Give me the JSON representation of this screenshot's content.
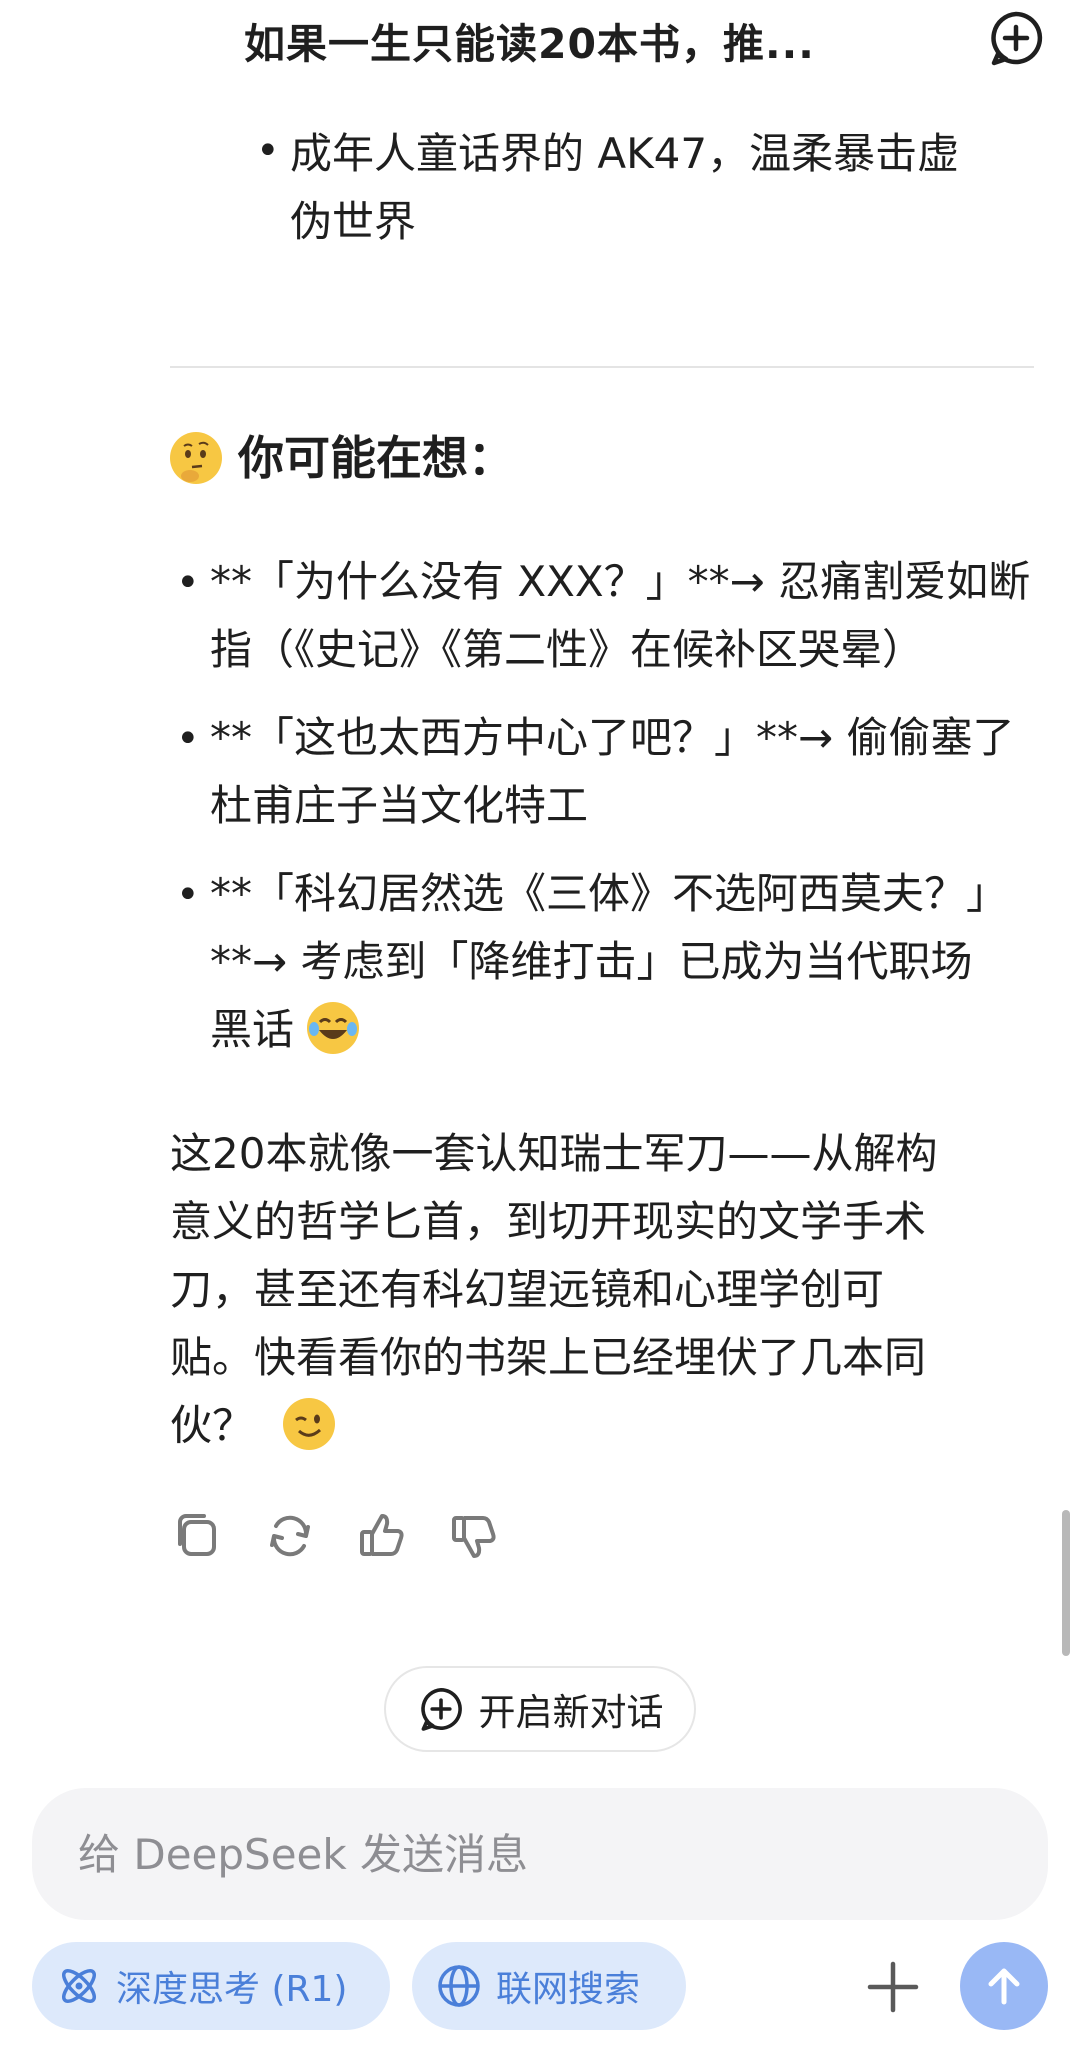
{
  "header": {
    "title": "如果一生只能读20本书，推..."
  },
  "previous_bullet": {
    "line1": "成年人童话界的 AK47，温柔暴击虚",
    "line2": "伪世界"
  },
  "section": {
    "emoji": "thinking-face",
    "title": "你可能在想："
  },
  "bullets": [
    {
      "line1": "**「为什么没有 XXX？」**→ 忍痛割爱如断",
      "line2": "指（《史记》《第二性》在候补区哭晕）"
    },
    {
      "line1": "**「这也太西方中心了吧？」**→ 偷偷塞了",
      "line2": "杜甫庄子当文化特工"
    },
    {
      "line1": "**「科幻居然选《三体》不选阿西莫夫？」",
      "line2": "**→ 考虑到「降维打击」已成为当代职场",
      "line3": "黑话",
      "emoji": "tears-of-joy"
    }
  ],
  "paragraph": {
    "lines": [
      "这20本就像一套认知瑞士军刀——从解构",
      "意义的哲学匕首，到切开现实的文学手术",
      "刀，甚至还有科幻望远镜和心理学创可",
      "贴。快看看你的书架上已经埋伏了几本同",
      "伙？"
    ],
    "emoji": "winking-face"
  },
  "actions": [
    "copy-icon",
    "regenerate-icon",
    "thumbs-up-icon",
    "thumbs-down-icon"
  ],
  "new_conversation": {
    "label": "开启新对话"
  },
  "composer": {
    "placeholder": "给 DeepSeek 发送消息",
    "deep_think_label": "深度思考 (R1)",
    "web_search_label": "联网搜索"
  },
  "colors": {
    "accent": "#4a7fd9",
    "chip_bg": "#dde9fb",
    "send_bg": "#99b8f5"
  }
}
